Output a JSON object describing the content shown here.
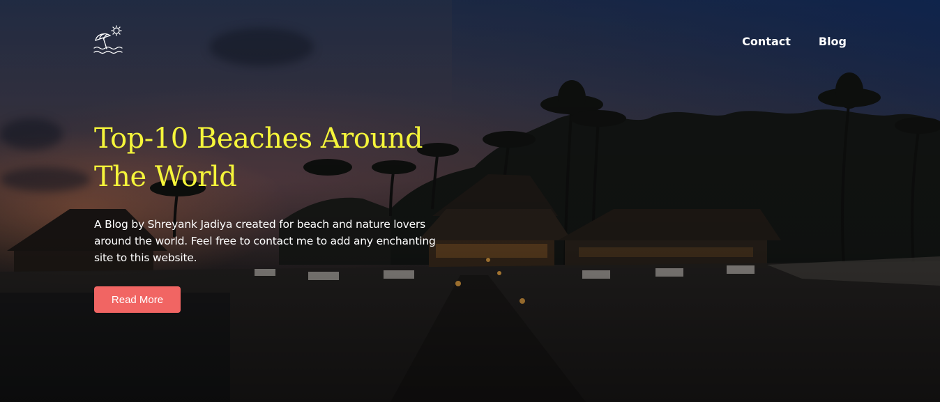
{
  "page": {
    "background_theme": "beach resort at dusk with palm trees"
  },
  "header": {
    "logo_icon": "beach-umbrella-sun-waves-icon",
    "nav": [
      {
        "label": "Contact"
      },
      {
        "label": "Blog"
      }
    ]
  },
  "hero": {
    "title": "Top-10 Beaches Around The World",
    "description": "A Blog by Shreyank Jadiya created for beach and nature lovers around the world. Feel free to contact me to add any enchanting site to this website.",
    "cta_label": "Read More"
  },
  "colors": {
    "title": "#f5f53a",
    "cta_background": "#f16563",
    "nav_text": "#ffffff",
    "body_text": "#ffffff"
  }
}
